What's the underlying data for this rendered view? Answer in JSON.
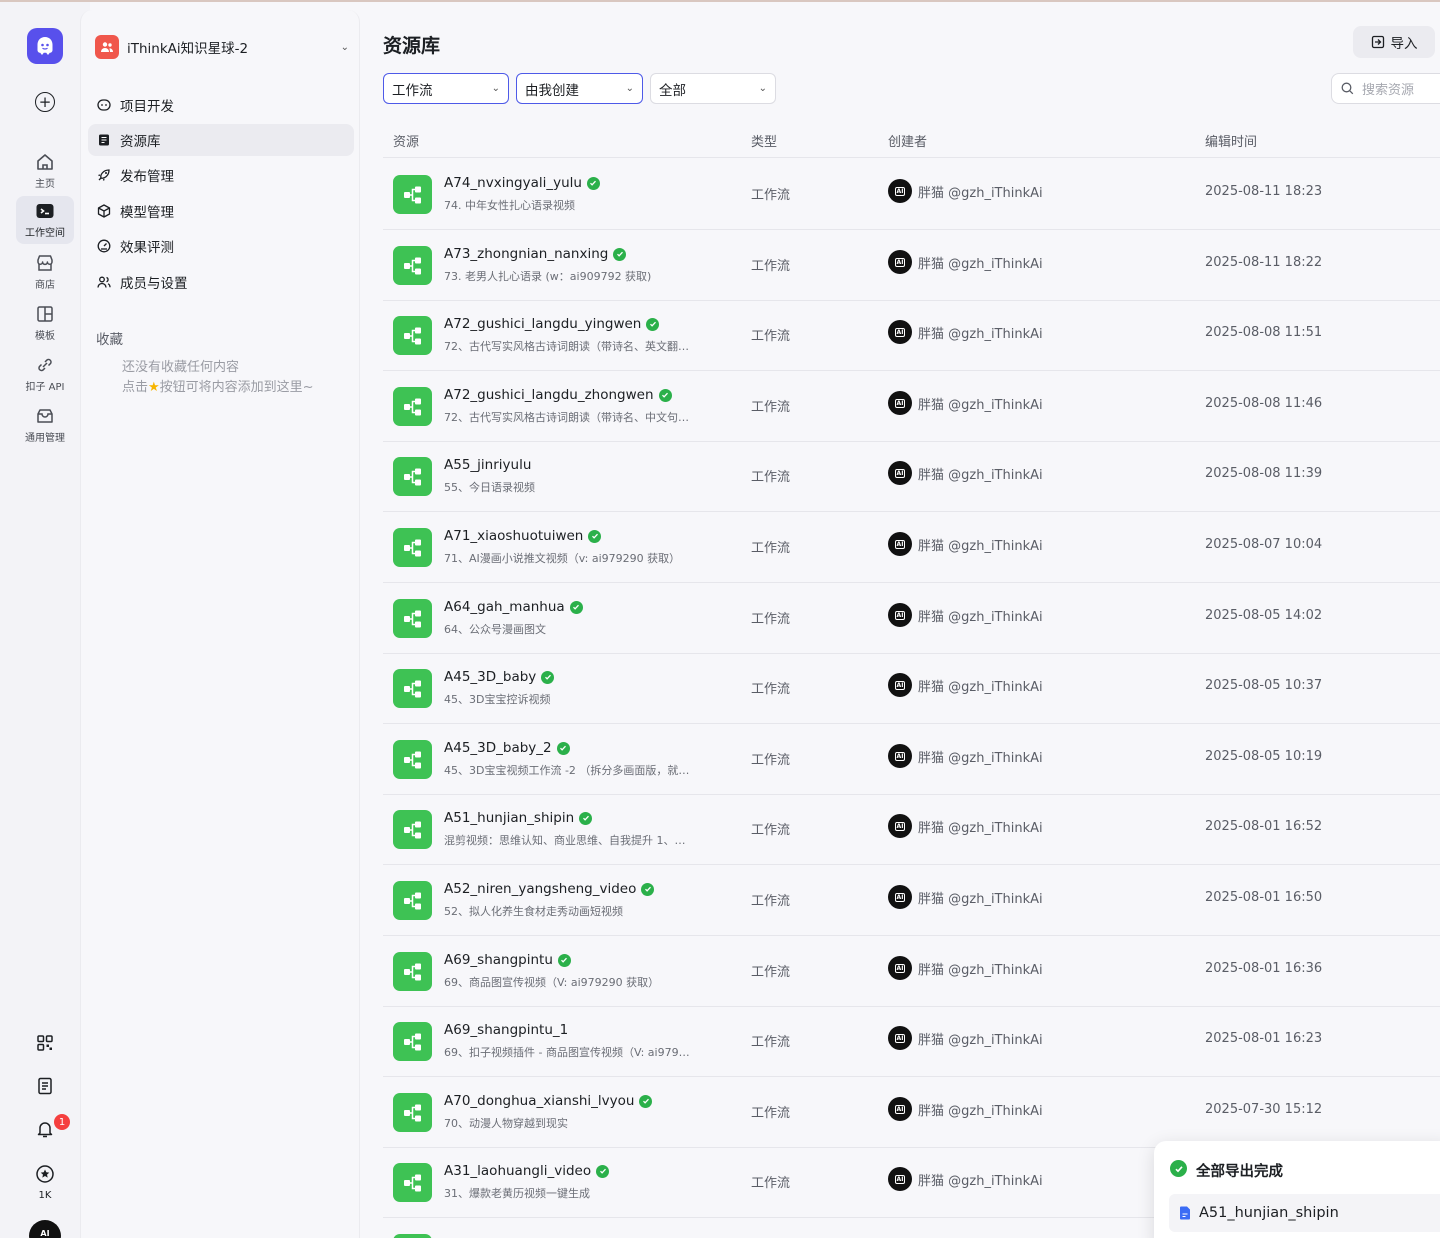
{
  "rail": {
    "items": [
      {
        "label": "主页",
        "icon": "home-icon"
      },
      {
        "label": "工作空间",
        "icon": "workspace-icon"
      },
      {
        "label": "商店",
        "icon": "store-icon"
      },
      {
        "label": "模板",
        "icon": "template-icon"
      },
      {
        "label": "扣子 API",
        "icon": "api-icon"
      },
      {
        "label": "通用管理",
        "icon": "admin-icon"
      }
    ],
    "notification_count": "1",
    "star_count": "1K",
    "avatar_text": "AI"
  },
  "sidebar": {
    "space_name": "iThinkAi知识星球-2",
    "nav": [
      {
        "label": "项目开发"
      },
      {
        "label": "资源库"
      },
      {
        "label": "发布管理"
      },
      {
        "label": "模型管理"
      },
      {
        "label": "效果评测"
      },
      {
        "label": "成员与设置"
      }
    ],
    "favorites_title": "收藏",
    "favorites_empty_line1": "还没有收藏任何内容",
    "favorites_empty_line2_prefix": "点击",
    "favorites_empty_line2_suffix": "按钮可将内容添加到这里~"
  },
  "main": {
    "title": "资源库",
    "import_label": "导入",
    "filters": [
      {
        "value": "工作流"
      },
      {
        "value": "由我创建"
      },
      {
        "value": "全部"
      }
    ],
    "search_placeholder": "搜索资源",
    "columns": {
      "resource": "资源",
      "type": "类型",
      "creator": "创建者",
      "edited": "编辑时间"
    },
    "rows": [
      {
        "name": "A74_nvxingyali_yulu",
        "desc": "74. 中年女性扎心语录视频",
        "type": "工作流",
        "creator": "胖猫 @gzh_iThinkAi",
        "time": "2025-08-11 18:23"
      },
      {
        "name": "A73_zhongnian_nanxing",
        "desc": "73. 老男人扎心语录 (w：ai909792 获取)",
        "type": "工作流",
        "creator": "胖猫 @gzh_iThinkAi",
        "time": "2025-08-11 18:22"
      },
      {
        "name": "A72_gushici_langdu_yingwen",
        "desc": "72、古代写实风格古诗词朗读（带诗名、英文翻…",
        "type": "工作流",
        "creator": "胖猫 @gzh_iThinkAi",
        "time": "2025-08-08 11:51"
      },
      {
        "name": "A72_gushici_langdu_zhongwen",
        "desc": "72、古代写实风格古诗词朗读（带诗名、中文句…",
        "type": "工作流",
        "creator": "胖猫 @gzh_iThinkAi",
        "time": "2025-08-08 11:46"
      },
      {
        "name": "A55_jinriyulu",
        "desc": "55、今日语录视频",
        "type": "工作流",
        "creator": "胖猫 @gzh_iThinkAi",
        "time": "2025-08-08 11:39"
      },
      {
        "name": "A71_xiaoshuotuiwen",
        "desc": "71、AI漫画小说推文视频（v: ai979290 获取）",
        "type": "工作流",
        "creator": "胖猫 @gzh_iThinkAi",
        "time": "2025-08-07 10:04"
      },
      {
        "name": "A64_gah_manhua",
        "desc": "64、公众号漫画图文",
        "type": "工作流",
        "creator": "胖猫 @gzh_iThinkAi",
        "time": "2025-08-05 14:02"
      },
      {
        "name": "A45_3D_baby",
        "desc": "45、3D宝宝控诉视频",
        "type": "工作流",
        "creator": "胖猫 @gzh_iThinkAi",
        "time": "2025-08-05 10:37"
      },
      {
        "name": "A45_3D_baby_2",
        "desc": "45、3D宝宝视频工作流 -2 （拆分多画面版，就…",
        "type": "工作流",
        "creator": "胖猫 @gzh_iThinkAi",
        "time": "2025-08-05 10:19"
      },
      {
        "name": "A51_hunjian_shipin",
        "desc": "混剪视频：思维认知、商业思维、自我提升 1、…",
        "type": "工作流",
        "creator": "胖猫 @gzh_iThinkAi",
        "time": "2025-08-01 16:52"
      },
      {
        "name": "A52_niren_yangsheng_video",
        "desc": "52、拟人化养生食材走秀动画短视频",
        "type": "工作流",
        "creator": "胖猫 @gzh_iThinkAi",
        "time": "2025-08-01 16:50"
      },
      {
        "name": "A69_shangpintu",
        "desc": "69、商品图宣传视频（V: ai979290 获取）",
        "type": "工作流",
        "creator": "胖猫 @gzh_iThinkAi",
        "time": "2025-08-01 16:36"
      },
      {
        "name": "A69_shangpintu_1",
        "desc": "69、扣子视频插件 - 商品图宣传视频（V: ai979…",
        "type": "工作流",
        "creator": "胖猫 @gzh_iThinkAi",
        "time": "2025-08-01 16:23"
      },
      {
        "name": "A70_donghua_xianshi_lvyou",
        "desc": "70、动漫人物穿越到现实",
        "type": "工作流",
        "creator": "胖猫 @gzh_iThinkAi",
        "time": "2025-07-30 15:12"
      },
      {
        "name": "A31_laohuangli_video",
        "desc": "31、爆款老黄历视频一键生成",
        "type": "工作流",
        "creator": "胖猫 @gzh_iThinkAi",
        "time": ""
      }
    ],
    "verified_flags": [
      true,
      true,
      true,
      true,
      false,
      true,
      true,
      true,
      true,
      true,
      true,
      true,
      false,
      true,
      true
    ]
  },
  "toast": {
    "title": "全部导出完成",
    "file": "A51_hunjian_shipin"
  },
  "colors": {
    "accent": "#4e5ae8",
    "workflow_green": "#3ec254",
    "verified_green": "#2bb04a",
    "brand_purple": "#5850ec"
  }
}
